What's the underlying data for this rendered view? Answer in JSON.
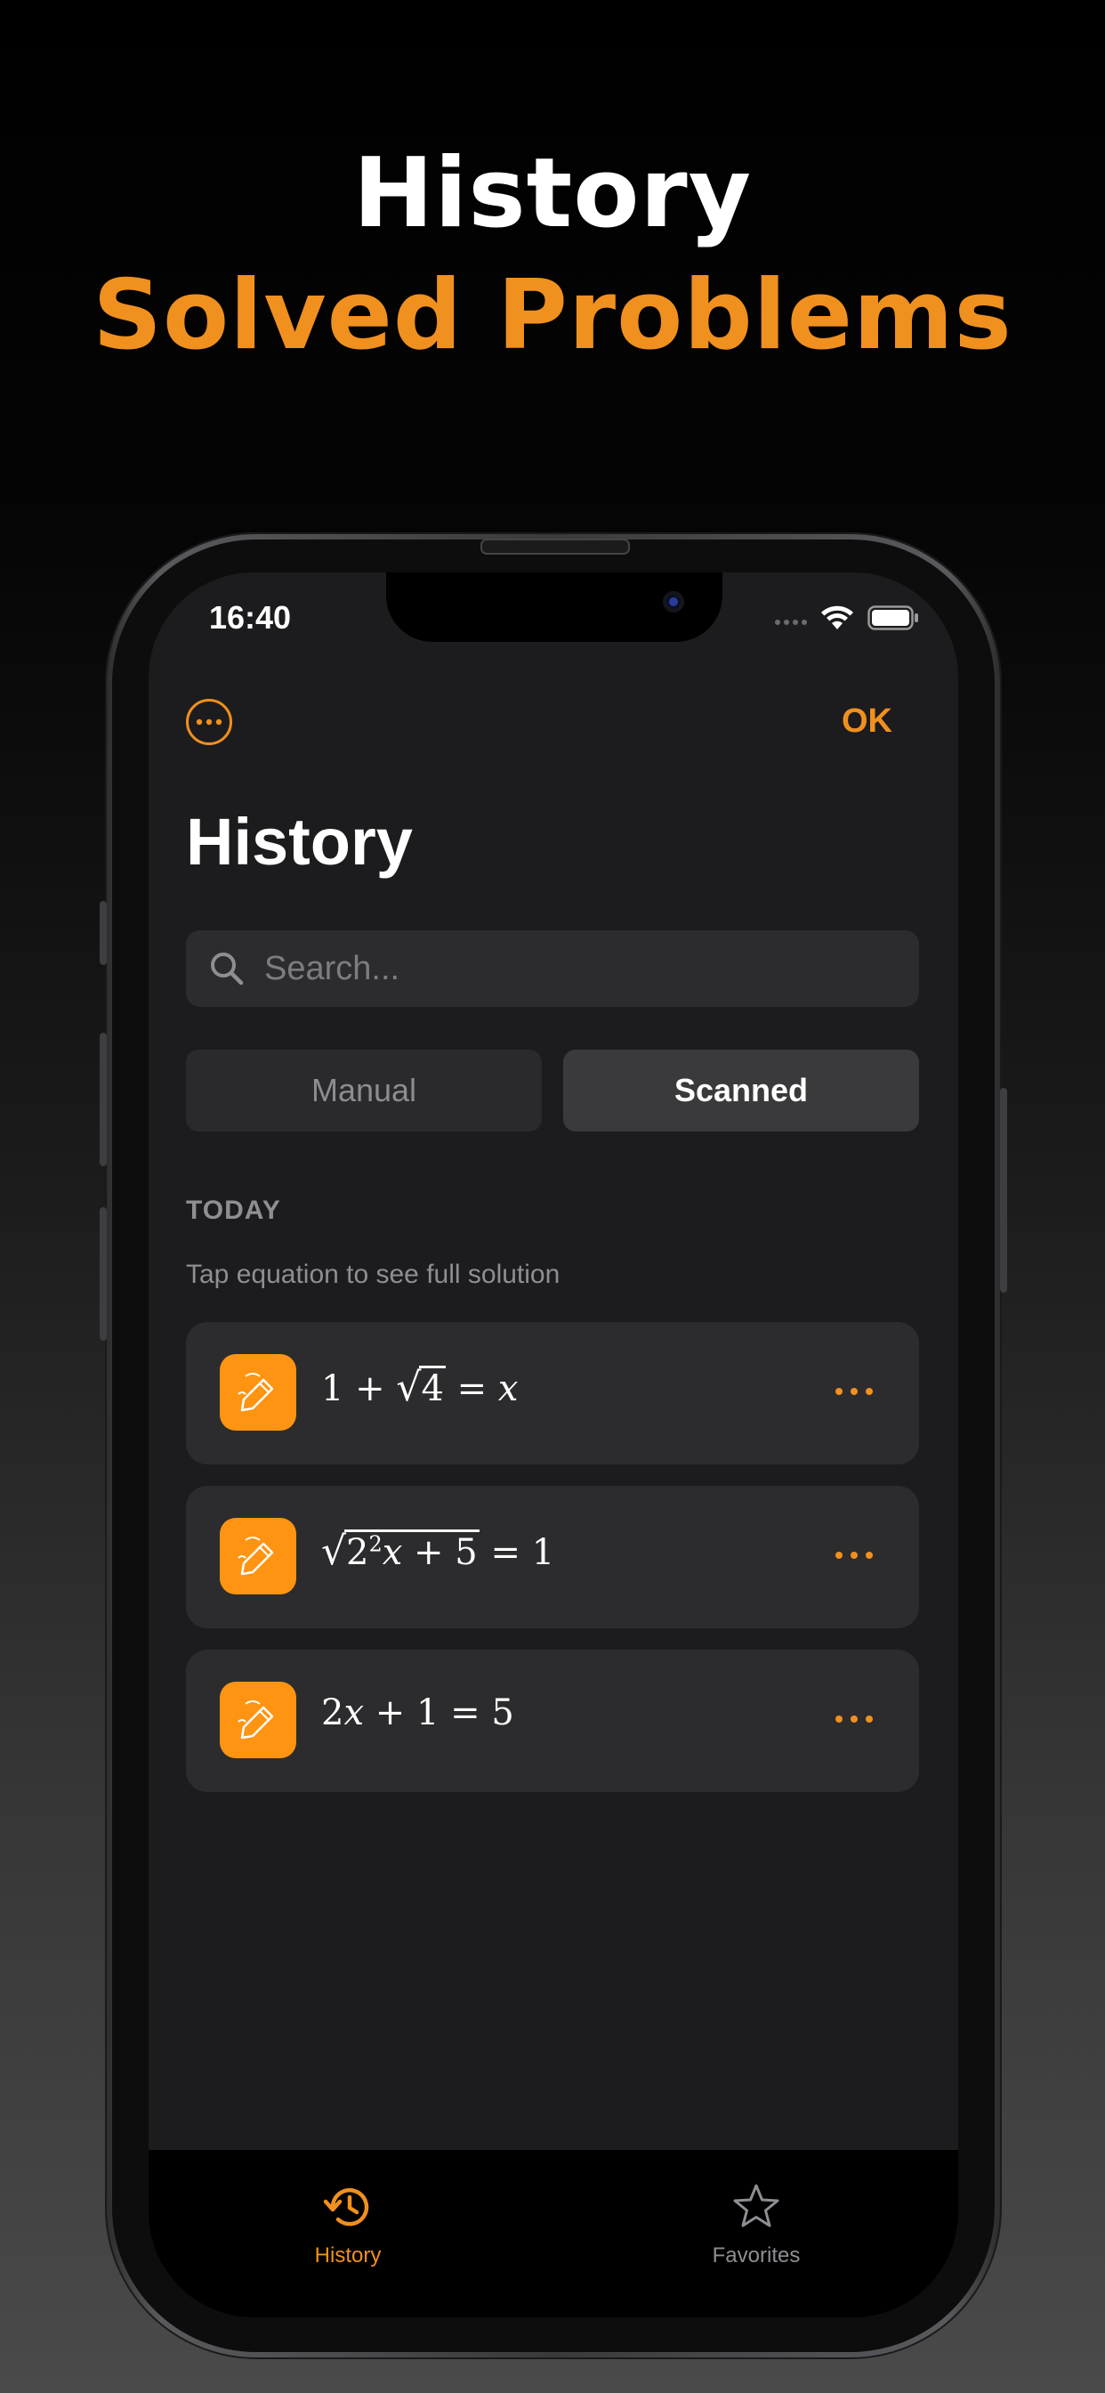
{
  "headline": {
    "line1": "History",
    "line2": "Solved Problems"
  },
  "status_bar": {
    "time": "16:40"
  },
  "nav": {
    "ok_label": "OK"
  },
  "page": {
    "title": "History"
  },
  "search": {
    "placeholder": "Search...",
    "value": ""
  },
  "segments": {
    "items": [
      {
        "label": "Manual",
        "selected": false
      },
      {
        "label": "Scanned",
        "selected": true
      }
    ]
  },
  "section": {
    "header": "TODAY",
    "hint": "Tap equation to see full solution"
  },
  "equations": {
    "items": [
      {
        "parts": [
          "1 + ",
          "4",
          " = ",
          "x"
        ]
      },
      {
        "parts": [
          "2",
          "2",
          "x",
          " + 5",
          " = 1"
        ]
      },
      {
        "parts": [
          "2",
          "x",
          " + 1 = 5"
        ]
      }
    ]
  },
  "tab_bar": {
    "items": [
      {
        "label": "History",
        "icon": "clock-history-icon",
        "active": true
      },
      {
        "label": "Favorites",
        "icon": "star-icon",
        "active": false
      }
    ]
  },
  "colors": {
    "accent": "#f0901e",
    "icon_bg": "#ff9412",
    "screen_bg": "#1c1c1e",
    "card_bg": "#2c2c2e"
  }
}
